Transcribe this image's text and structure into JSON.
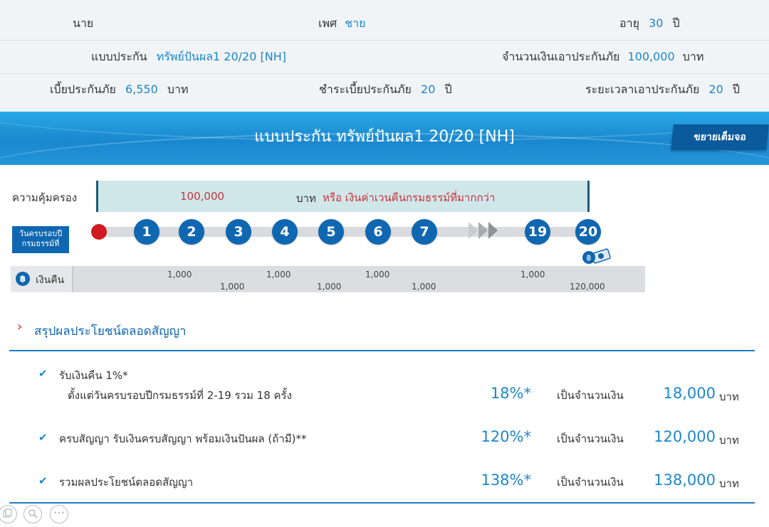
{
  "info": {
    "title_label": "นาย",
    "gender_label": "เพศ",
    "gender_value": "ชาย",
    "age_label": "อายุ",
    "age_value": "30",
    "age_unit": "ปี",
    "plan_label": "แบบประกัน",
    "plan_value": "ทรัพย์ปันผล1 20/20 [NH]",
    "sum_label": "จำนวนเงินเอาประกันภัย",
    "sum_value": "100,000",
    "sum_unit": "บาท",
    "premium_label": "เบี้ยประกันภัย",
    "premium_value": "6,550",
    "premium_unit": "บาท",
    "pay_label": "ชำระเบี้ยประกันภัย",
    "pay_value": "20",
    "pay_unit": "ปี",
    "cover_label": "ระยะเวลาเอาประกันภัย",
    "cover_value": "20",
    "cover_unit": "ปี"
  },
  "banner": {
    "title": "แบบประกัน ทรัพย์ปันผล1 20/20 [NH]",
    "expand_label": "ขยายเต็มจอ"
  },
  "coverage": {
    "label": "ความคุ้มครอง",
    "amount": "100,000",
    "unit": "บาท",
    "note": "หรือ เงินค่าเวนคืนกรมธรรม์ที่มากกว่า"
  },
  "timeline": {
    "label_line1": "วันครบรอบปี",
    "label_line2": "กรมธรรม์ที่",
    "years": [
      "1",
      "2",
      "3",
      "4",
      "5",
      "6",
      "7",
      "19",
      "20"
    ]
  },
  "refund": {
    "label": "เงินคืน",
    "coin_symbol": "฿",
    "top_values": [
      "1,000",
      "1,000",
      "1,000",
      "1,000"
    ],
    "bottom_values": [
      "1,000",
      "1,000",
      "1,000",
      "120,000"
    ]
  },
  "summary": {
    "title": "สรุปผลประโยชน์ตลอดสัญญา",
    "amount_prefix": "เป็นจำนวนเงิน",
    "currency": "บาท",
    "items": [
      {
        "line1": "รับเงินคืน 1%*",
        "line2": "ตั้งแต่วันครบรอบปีกรมธรรม์ที่ 2-19 รวม 18 ครั้ง",
        "percent": "18%*",
        "amount": "18,000"
      },
      {
        "line1": "ครบสัญญา รับเงินครบสัญญา พร้อมเงินปันผล (ถ้ามี)**",
        "percent": "120%*",
        "amount": "120,000"
      },
      {
        "line1": "รวมผลประโยชน์ตลอดสัญญา",
        "percent": "138%*",
        "amount": "138,000"
      }
    ]
  },
  "controls": {
    "more_label": "•••"
  },
  "colors": {
    "accent": "#1c87c9",
    "dark_blue": "#0f67b1",
    "red": "#d01a22",
    "coverage_bg": "#d0e7ea"
  }
}
